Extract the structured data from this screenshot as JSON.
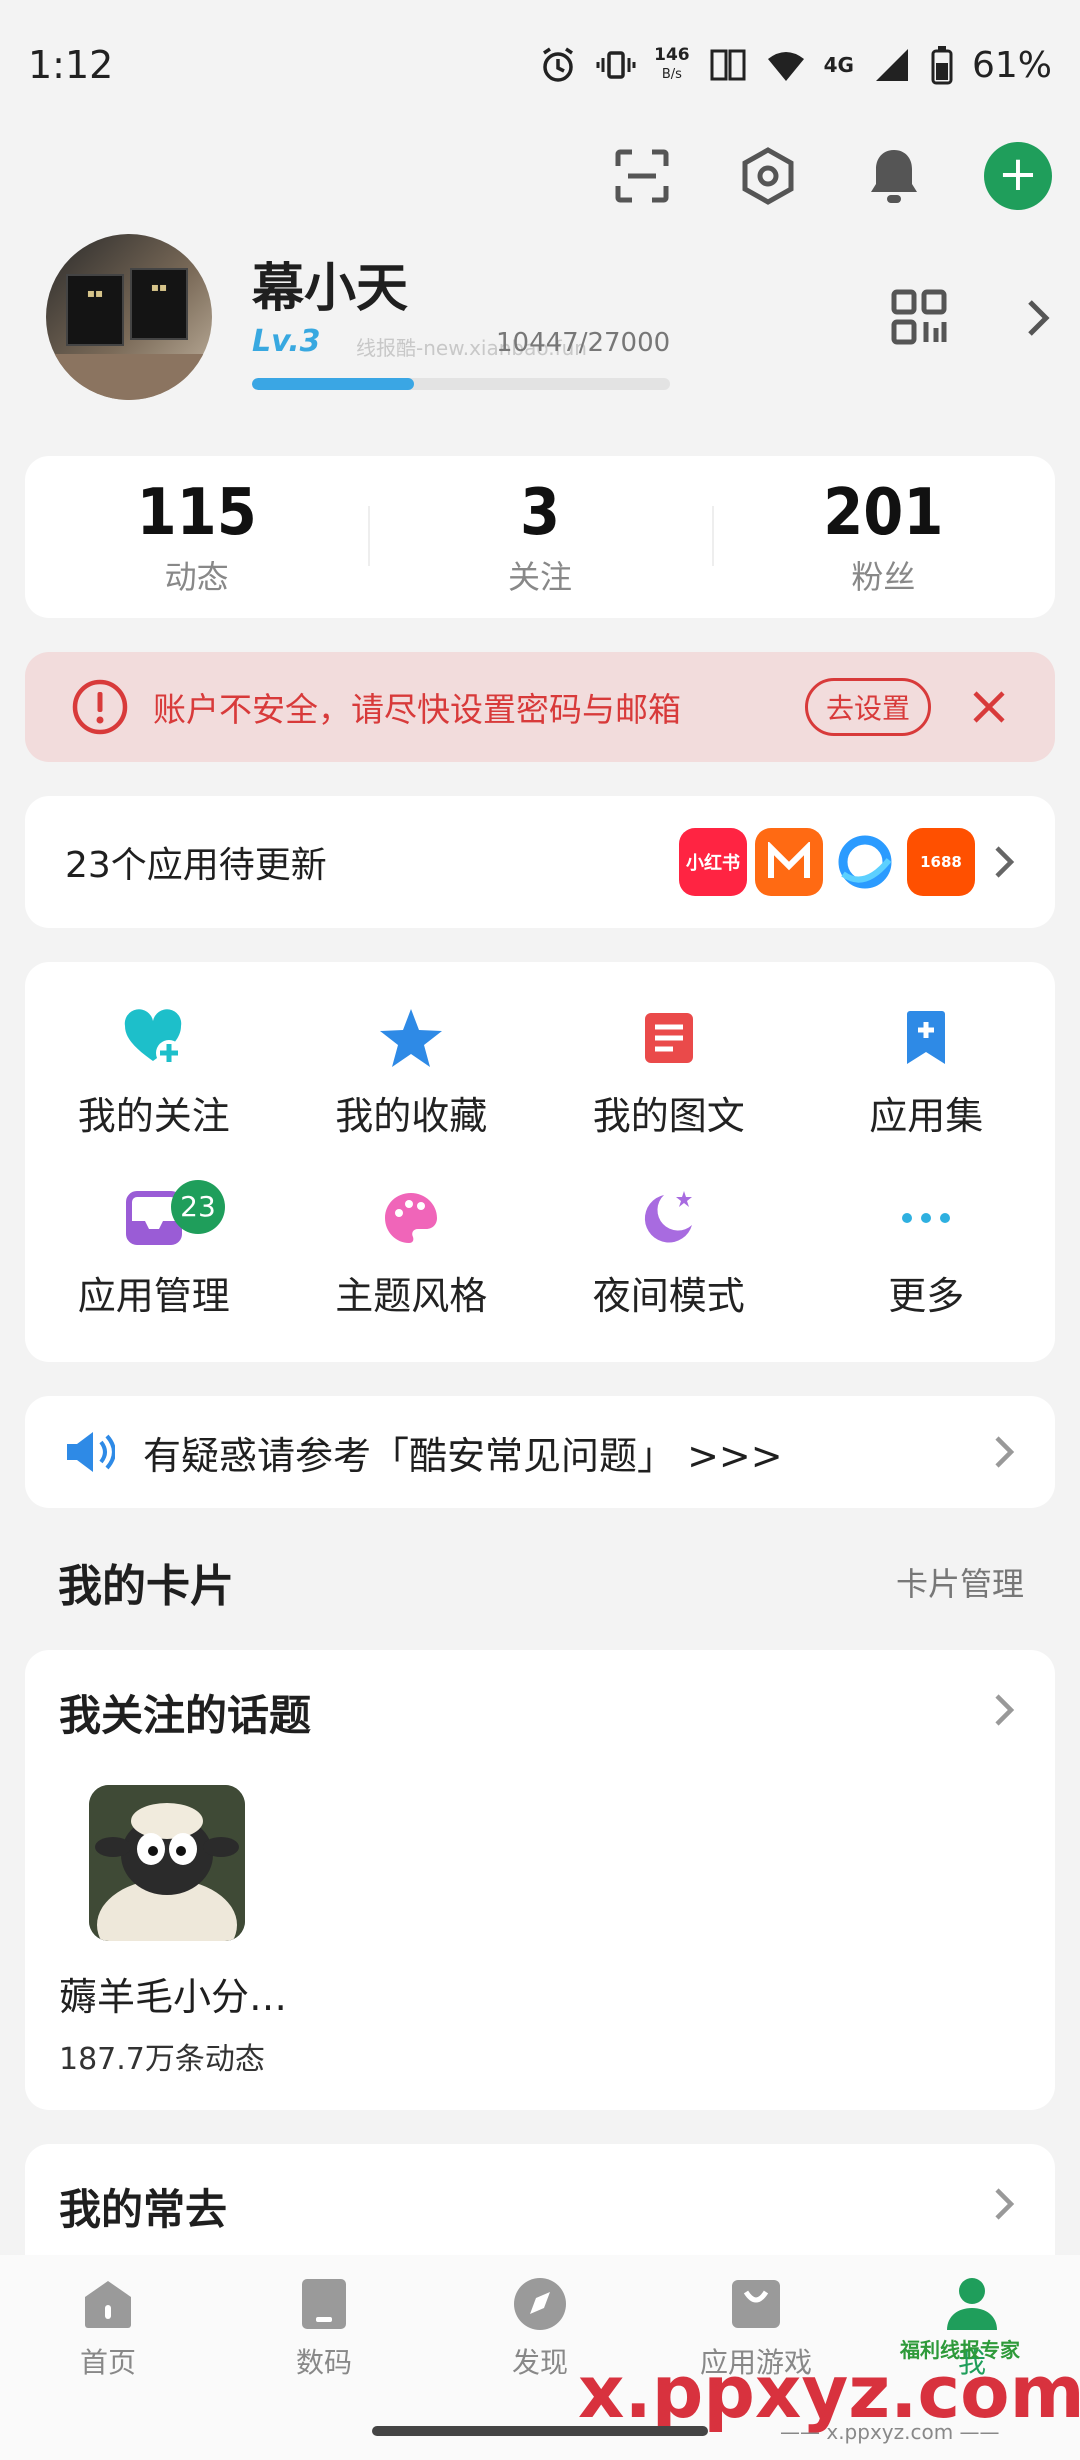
{
  "status_bar": {
    "time": "1:12",
    "net_speed_value": "146",
    "net_speed_unit": "B/s",
    "network": "4G",
    "battery": "61%"
  },
  "top_actions": {
    "scan": "scan-icon",
    "settings": "hexagon-settings-icon",
    "notifications": "bell-icon",
    "add": "plus-icon",
    "accent_color": "#1f9e5b"
  },
  "profile": {
    "name": "幕小天",
    "level": "Lv.3",
    "exp_text": "10447/27000",
    "exp_fraction": 0.387,
    "watermark": "线报酷-new.xianbao.fun"
  },
  "stats": [
    {
      "num": "115",
      "label": "动态"
    },
    {
      "num": "3",
      "label": "关注"
    },
    {
      "num": "201",
      "label": "粉丝"
    }
  ],
  "alert": {
    "text": "账户不安全，请尽快设置密码与邮箱",
    "button": "去设置",
    "color": "#d83a3a"
  },
  "updates": {
    "text": "23个应用待更新",
    "apps": [
      {
        "name": "小红书",
        "color": "#ff2442"
      },
      {
        "name": "芒果TV",
        "color": "#ff6a13"
      },
      {
        "name": "QQ浏览器",
        "color": "#2b9bff"
      },
      {
        "name": "1688",
        "color": "#ff5000"
      }
    ]
  },
  "grid": [
    {
      "label": "我的关注",
      "icon": "heart-plus-icon",
      "color": "#1dbfca"
    },
    {
      "label": "我的收藏",
      "icon": "star-icon",
      "color": "#2e8ae6"
    },
    {
      "label": "我的图文",
      "icon": "document-icon",
      "color": "#ea4a4a"
    },
    {
      "label": "应用集",
      "icon": "bookmark-plus-icon",
      "color": "#2e8ae6"
    },
    {
      "label": "应用管理",
      "icon": "tray-icon",
      "color": "#9a5cd6",
      "badge": "23"
    },
    {
      "label": "主题风格",
      "icon": "palette-icon",
      "color": "#f065b9"
    },
    {
      "label": "夜间模式",
      "icon": "moon-star-icon",
      "color": "#a86be0"
    },
    {
      "label": "更多",
      "icon": "more-dots-icon",
      "color": "#2eb0e0"
    }
  ],
  "faq": {
    "text": "有疑惑请参考「酷安常见问题」 >>>"
  },
  "cards_section": {
    "title": "我的卡片",
    "manage": "卡片管理"
  },
  "topics_card": {
    "title": "我关注的话题",
    "topic_name": "薅羊毛小分…",
    "topic_count": "187.7万条动态"
  },
  "frequent_card": {
    "title": "我的常去"
  },
  "tabs": [
    {
      "label": "首页",
      "icon": "home-icon"
    },
    {
      "label": "数码",
      "icon": "phone-icon"
    },
    {
      "label": "发现",
      "icon": "compass-icon"
    },
    {
      "label": "应用游戏",
      "icon": "bag-icon"
    },
    {
      "label": "我",
      "icon": "person-icon",
      "active": true
    }
  ],
  "overlay_watermark": {
    "main": "x.ppxyz.com",
    "tag": "福利线报专家",
    "sub": "—— x.ppxyz.com ——"
  }
}
